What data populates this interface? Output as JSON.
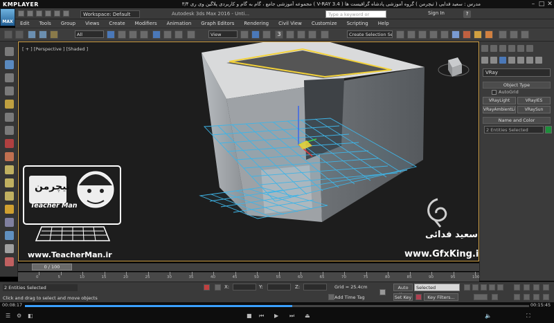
{
  "player": {
    "name": "KMPLAYER",
    "title": "مجموعه آموزشی جامع ، گام به گام و کاربردی پلاگین وی ری ۳/۴  ( V-RAY 3.4 )  مدرس : سعید فدایی ( تیچرمن ) گروه آموزشی پادشاه گرافیست ها",
    "time_current": "00:08:17",
    "time_total": "00:15:45",
    "progress": 0.53
  },
  "app": {
    "logo_text": "MAX",
    "workspace": "Workspace: Default",
    "title": "Autodesk 3ds Max 2016 - Unti...",
    "search_placeholder": "Type a keyword or phrase",
    "sign_in": "Sign In",
    "help": "?"
  },
  "menu": [
    "Edit",
    "Tools",
    "Group",
    "Views",
    "Create",
    "Modifiers",
    "Animation",
    "Graph Editors",
    "Rendering",
    "Civil View",
    "Customize",
    "Scripting",
    "Help"
  ],
  "toolbar": {
    "selection_filter": "All",
    "ref_coord": "View",
    "snap_label": "3",
    "selection_set": "Create Selection Se"
  },
  "viewport": {
    "label": "[ + ] [Perspective ] [Shaded ]"
  },
  "command_panel": {
    "category": "VRay",
    "object_type_title": "Object Type",
    "autogrid": "AutoGrid",
    "buttons": [
      "VRayLight",
      "VRayIES",
      "VRayAmbientLig",
      "VRaySun"
    ],
    "name_color_title": "Name and Color",
    "name_value": "2 Entities Selected",
    "color": "#1d8f3b"
  },
  "timeline": {
    "slider": "0 / 100",
    "ticks": [
      "0",
      "5",
      "10",
      "15",
      "20",
      "25",
      "30",
      "35",
      "40",
      "45",
      "50",
      "55",
      "60",
      "65",
      "70",
      "75",
      "80",
      "85",
      "90",
      "95",
      "100"
    ]
  },
  "status": {
    "selection": "2 Entities Selected",
    "prompt": "Click and drag to select and move objects",
    "x_label": "X:",
    "y_label": "Y:",
    "z_label": "Z:",
    "grid": "Grid = 25.4cm",
    "add_time_tag": "Add Time Tag",
    "auto_key": "Auto Key",
    "set_key": "Set Key",
    "key_mode": "Selected",
    "key_filters": "Key Filters..."
  },
  "watermarks": {
    "teacherman_fa": "تیچرمن",
    "teacherman_en": "Teacher Man",
    "teacherman_url": "www.TeacherMan.ir",
    "gfx_name": "سعید فدائی",
    "gfx_url": "www.GfxKing.ir"
  }
}
